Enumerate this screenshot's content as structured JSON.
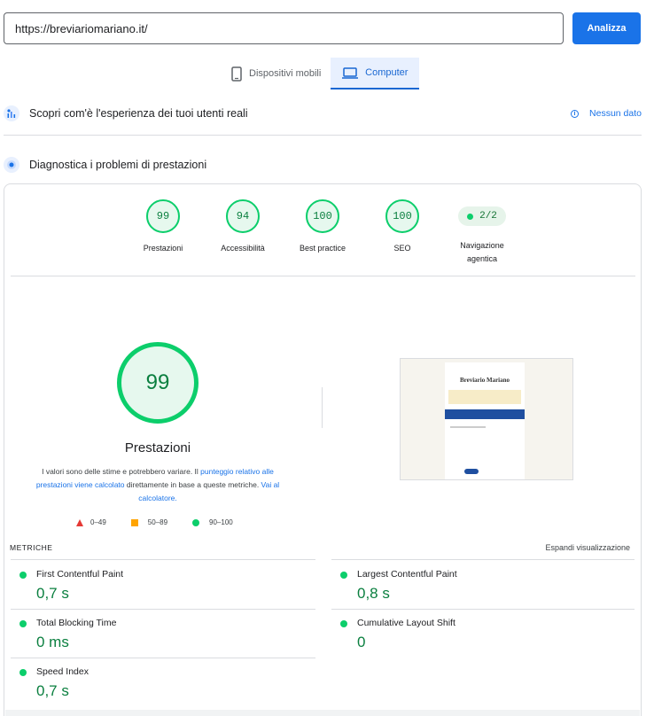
{
  "url_input": {
    "value": "https://breviariomariano.it/"
  },
  "analyze_button": "Analizza",
  "device_tabs": [
    {
      "label": "Dispositivi mobili",
      "icon": "smartphone-icon",
      "active": false
    },
    {
      "label": "Computer",
      "icon": "laptop-icon",
      "active": true
    }
  ],
  "field_data": {
    "label": "Scopri com'è l'esperienza dei tuoi utenti reali",
    "status": "Nessun dato"
  },
  "lab_data": {
    "label": "Diagnostica i problemi di prestazioni"
  },
  "categories": [
    {
      "score": "99",
      "label": "Prestazioni"
    },
    {
      "score": "94",
      "label": "Accessibilità"
    },
    {
      "score": "100",
      "label": "Best practice"
    },
    {
      "score": "100",
      "label": "SEO"
    },
    {
      "score": "2/2",
      "label_line1": "Navigazione",
      "label_line2": "agentica"
    }
  ],
  "performance": {
    "score": "99",
    "title": "Prestazioni",
    "disclaimer_1": "I valori sono delle stime e potrebbero variare. Il ",
    "disclaimer_link_1": "punteggio relativo alle prestazioni viene calcolato",
    "disclaimer_2": " direttamente in base a queste metriche. ",
    "disclaimer_link_2": "Vai al calcolatore."
  },
  "legend": [
    "0–49",
    "50–89",
    "90–100"
  ],
  "screenshot": {
    "brand": "Breviario Mariano"
  },
  "metrics_header": "METRICHE",
  "expand_label": "Espandi visualizzazione",
  "metrics": [
    {
      "name": "First Contentful Paint",
      "value": "0,7 s"
    },
    {
      "name": "Largest Contentful Paint",
      "value": "0,8 s"
    },
    {
      "name": "Total Blocking Time",
      "value": "0 ms"
    },
    {
      "name": "Cumulative Layout Shift",
      "value": "0"
    },
    {
      "name": "Speed Index",
      "value": "0,7 s"
    }
  ],
  "colors": {
    "pass": "#0cce6b",
    "average": "#ffa400",
    "fail": "#e53935",
    "accent": "#1a73e8"
  }
}
